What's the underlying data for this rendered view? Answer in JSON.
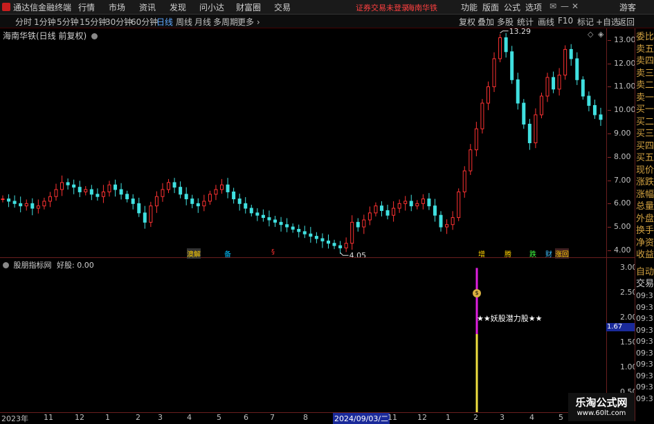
{
  "menu": {
    "app_title": "通达信金融终端",
    "items": [
      "行情",
      "市场",
      "资讯",
      "发现",
      "问小达",
      "财富圈",
      "交易"
    ],
    "warning": "证券交易未登录",
    "stock_link": "海南华铁",
    "right_items": [
      "功能",
      "版面",
      "公式",
      "选项"
    ],
    "guest": "游客"
  },
  "toolbar": {
    "periods": [
      "分时",
      "1分钟",
      "5分钟",
      "15分钟",
      "30分钟",
      "60分钟",
      "日线",
      "周线",
      "月线",
      "多周期",
      "更多 ›"
    ],
    "active_period": "日线",
    "tools": [
      "复权",
      "叠加",
      "多股",
      "统计",
      "画线",
      "F10",
      "标记",
      "+自选",
      "返回"
    ]
  },
  "main_chart": {
    "title": "海南华铁(日线 前复权)",
    "high_label": "13.29",
    "low_label": "4.05",
    "y_ticks": [
      "13.00",
      "12.00",
      "11.00",
      "10.00",
      "9.00",
      "8.00",
      "7.00",
      "6.00",
      "5.00",
      "4.00"
    ],
    "event_tags": [
      "澳解",
      "备",
      "增",
      "腾",
      "跌",
      "财",
      "涨回"
    ]
  },
  "sub_chart": {
    "title": "股朋指标网",
    "value_label": "好股: 0.00",
    "signal_text": "★★妖股潜力股★★",
    "current_value": "1.67",
    "y_ticks": [
      "3.00",
      "2.50",
      "2.00",
      "1.50",
      "1.00",
      "0.50"
    ]
  },
  "right_panel": {
    "items": [
      "委比",
      "卖五",
      "卖四",
      "卖三",
      "卖二",
      "卖一",
      "买一",
      "买二",
      "买三",
      "买四",
      "买五",
      "现价",
      "涨跌",
      "涨幅",
      "总量",
      "外盘",
      "换手",
      "净资",
      "收益"
    ],
    "auto_trade": "自动",
    "auto_trade2": "交易",
    "times": [
      "09:31",
      "09:31",
      "09:31",
      "09:31",
      "09:31",
      "09:31",
      "09:31",
      "09:31",
      "09:31",
      "09:31"
    ]
  },
  "x_axis": {
    "labels": [
      "2023年",
      "11",
      "12",
      "1",
      "2",
      "3",
      "4",
      "5",
      "6",
      "7",
      "8",
      "2024/09/03/二",
      "11",
      "12",
      "1",
      "2",
      "3",
      "4",
      "5"
    ],
    "highlight": "2024/09/03/二"
  },
  "watermark": {
    "line1": "乐淘公式网",
    "line2": "www.60lt.com"
  },
  "chart_data": {
    "type": "candlestick",
    "title": "海南华铁(日线 前复权)",
    "ylim": [
      3.7,
      13.5
    ],
    "closes": [
      6.2,
      6.1,
      6.0,
      5.9,
      6.0,
      5.8,
      5.9,
      6.1,
      6.3,
      6.6,
      6.9,
      6.8,
      6.7,
      6.5,
      6.6,
      6.4,
      6.3,
      6.5,
      6.8,
      6.6,
      6.4,
      6.2,
      6.0,
      5.6,
      5.2,
      5.9,
      6.3,
      6.6,
      6.9,
      6.7,
      6.4,
      6.2,
      6.0,
      5.9,
      6.1,
      6.4,
      6.6,
      6.8,
      6.5,
      6.2,
      6.0,
      5.8,
      5.6,
      5.5,
      5.4,
      5.3,
      5.2,
      5.1,
      5.0,
      4.9,
      4.8,
      4.7,
      4.6,
      4.5,
      4.4,
      4.3,
      4.2,
      4.1,
      4.3,
      5.2,
      5.0,
      5.3,
      5.6,
      5.9,
      5.7,
      5.5,
      5.8,
      6.0,
      6.1,
      5.9,
      6.0,
      6.2,
      5.9,
      5.5,
      5.0,
      5.1,
      5.4,
      6.5,
      7.4,
      8.3,
      9.2,
      10.3,
      11.0,
      12.2,
      13.1,
      12.5,
      11.3,
      10.3,
      9.4,
      8.6,
      9.8,
      10.6,
      11.4,
      10.9,
      11.5,
      12.6,
      12.2,
      11.3,
      10.6,
      10.2,
      9.8,
      9.6
    ]
  }
}
